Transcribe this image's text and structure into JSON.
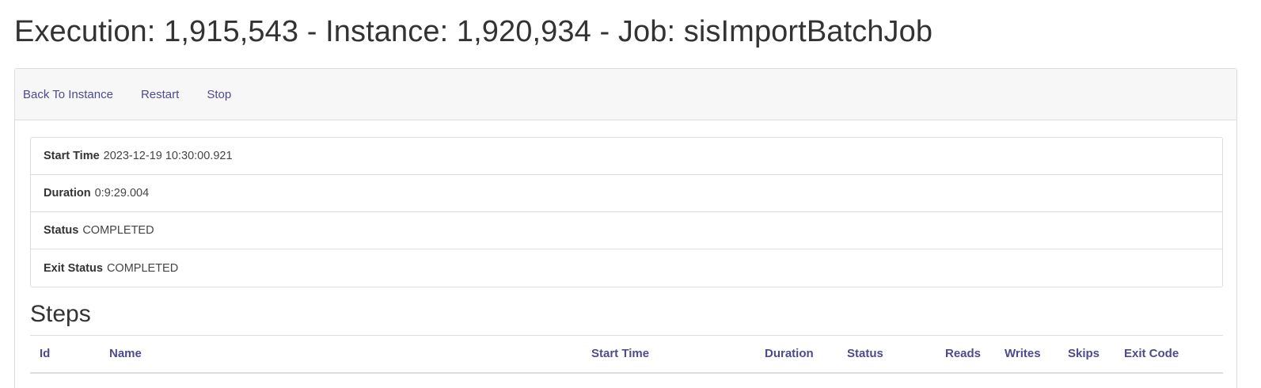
{
  "header": {
    "title": "Execution: 1,915,543 - Instance: 1,920,934 - Job: sisImportBatchJob"
  },
  "toolbar": {
    "back_label": "Back To Instance",
    "restart_label": "Restart",
    "stop_label": "Stop"
  },
  "details": {
    "start_time_label": "Start Time",
    "start_time_value": "2023-12-19 10:30:00.921",
    "duration_label": "Duration",
    "duration_value": "0:9:29.004",
    "status_label": "Status",
    "status_value": "COMPLETED",
    "exit_status_label": "Exit Status",
    "exit_status_value": "COMPLETED"
  },
  "steps": {
    "title": "Steps",
    "columns": [
      "Id",
      "Name",
      "Start Time",
      "Duration",
      "Status",
      "Reads",
      "Writes",
      "Skips",
      "Exit Code"
    ]
  },
  "colors": {
    "link": "#4e4a8f",
    "heading_bg": "#f7f7f7",
    "border": "#dddddd",
    "text": "#333333"
  }
}
